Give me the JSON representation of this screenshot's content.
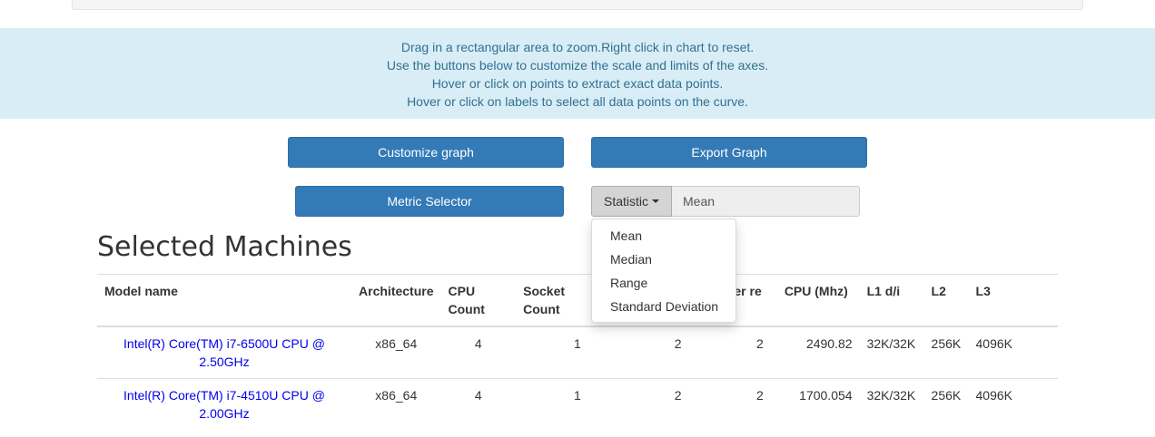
{
  "info": {
    "lines": [
      "Drag in a rectangular area to zoom.Right click in chart to reset.",
      "Use the buttons below to customize the scale and limits of the axes.",
      "Hover or click on points to extract exact data points.",
      "Hover or click on labels to select all data points on the curve."
    ]
  },
  "buttons": {
    "customize": "Customize graph",
    "export": "Export Graph",
    "metric": "Metric Selector",
    "statistic": "Statistic"
  },
  "statistic_value": "Mean",
  "dropdown": {
    "items": [
      "Mean",
      "Median",
      "Range",
      "Standard Deviation"
    ]
  },
  "section_title": "Selected Machines",
  "table": {
    "headers": [
      "Model name",
      "Architecture",
      "CPU Count",
      "Socket Count",
      "",
      "reads per re",
      "CPU (Mhz)",
      "L1 d/i",
      "L2",
      "L3"
    ],
    "rows": [
      [
        "Intel(R) Core(TM) i7-6500U CPU @ 2.50GHz",
        "x86_64",
        "4",
        "1",
        "2",
        "2",
        "2490.82",
        "32K/32K",
        "256K",
        "4096K"
      ],
      [
        "Intel(R) Core(TM) i7-4510U CPU @ 2.00GHz",
        "x86_64",
        "4",
        "1",
        "2",
        "2",
        "1700.054",
        "32K/32K",
        "256K",
        "4096K"
      ]
    ]
  },
  "colors": {
    "primary": "#337ab7",
    "info_bg": "#d9edf7",
    "info_text": "#31708f",
    "link": "#0000ee"
  }
}
